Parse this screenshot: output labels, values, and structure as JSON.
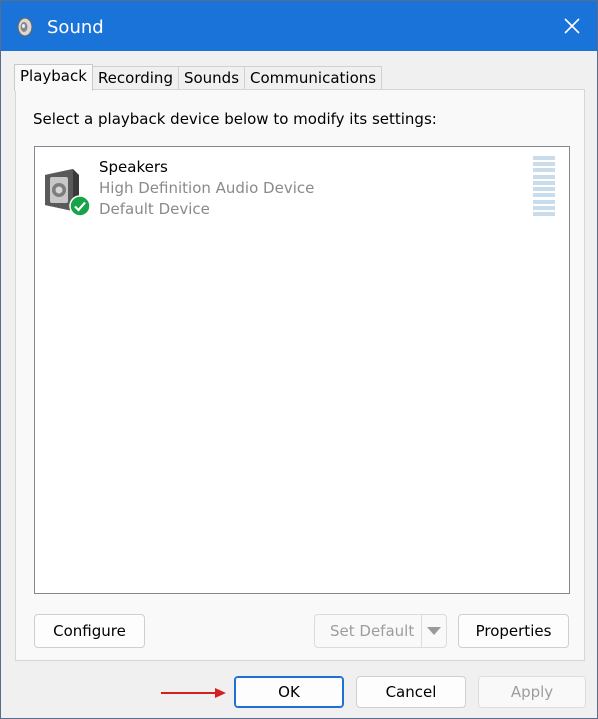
{
  "window": {
    "title": "Sound",
    "close_label": "✕"
  },
  "tabs": [
    {
      "label": "Playback",
      "active": true
    },
    {
      "label": "Recording",
      "active": false
    },
    {
      "label": "Sounds",
      "active": false
    },
    {
      "label": "Communications",
      "active": false
    }
  ],
  "playback": {
    "instruction": "Select a playback device below to modify its settings:",
    "devices": [
      {
        "name": "Speakers",
        "description": "High Definition Audio Device",
        "status": "Default Device",
        "icon": "speaker-icon",
        "badge_icon": "check-icon"
      }
    ],
    "buttons": {
      "configure": "Configure",
      "set_default": "Set Default",
      "properties": "Properties"
    }
  },
  "footer": {
    "ok": "OK",
    "cancel": "Cancel",
    "apply": "Apply"
  },
  "colors": {
    "titlebar": "#1a73d9",
    "default_badge": "#16a34a",
    "meter": "#c8dceb",
    "annotation_arrow": "#d42020"
  }
}
